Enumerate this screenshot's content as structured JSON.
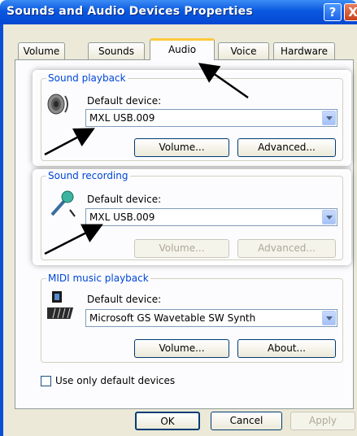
{
  "window": {
    "title": "Sounds and Audio Devices Properties",
    "help_glyph": "?",
    "close_glyph": "X"
  },
  "tabs": [
    {
      "label": "Volume"
    },
    {
      "label": "Sounds"
    },
    {
      "label": "Audio",
      "active": true
    },
    {
      "label": "Voice"
    },
    {
      "label": "Hardware"
    }
  ],
  "sound_playback": {
    "group_label": "Sound playback",
    "default_label": "Default device:",
    "device": "MXL USB.009",
    "volume_button": "Volume...",
    "advanced_button": "Advanced..."
  },
  "sound_recording": {
    "group_label": "Sound recording",
    "default_label": "Default device:",
    "device": "MXL USB.009",
    "volume_button": "Volume...",
    "advanced_button": "Advanced..."
  },
  "midi": {
    "group_label": "MIDI music playback",
    "default_label": "Default device:",
    "device": "Microsoft GS Wavetable SW Synth",
    "volume_button": "Volume...",
    "about_button": "About..."
  },
  "options": {
    "use_default_only": "Use only default devices",
    "use_default_only_checked": false
  },
  "footer": {
    "ok": "OK",
    "cancel": "Cancel",
    "apply": "Apply"
  },
  "colors": {
    "titlebar": "#0a58e0",
    "group_label": "#0046d5",
    "tab_highlight": "#ffc83c"
  }
}
